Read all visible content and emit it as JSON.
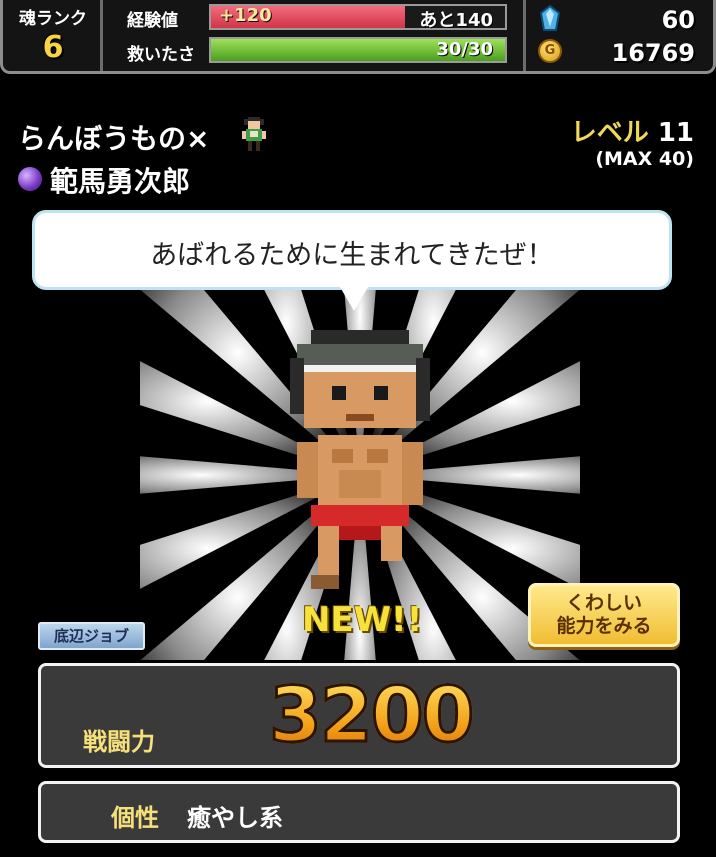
{
  "topbar": {
    "soul_rank_label": "魂ランク",
    "soul_rank_value": "6",
    "exp_label": "経験値",
    "exp_gain": "+120",
    "exp_remaining": "あと140",
    "exp_fill_fraction": 0.66,
    "rescued_label": "救いたさ",
    "rescued_value": "30/30",
    "rescued_fill_fraction": 1.0,
    "crystals": "60",
    "gold": "16769",
    "coin_glyph": "G"
  },
  "character": {
    "title": "らんぼうもの×",
    "name": "範馬勇次郎",
    "level_label": "レベル",
    "level_value": "11",
    "level_max": "(MAX 40)"
  },
  "speech": {
    "text": "あばれるために生まれてきたぜ！"
  },
  "badges": {
    "new": "NEW!!",
    "job": "底辺ジョブ"
  },
  "buttons": {
    "detail_line1": "くわしい",
    "detail_line2": "能力をみる"
  },
  "stats": {
    "power_label": "戦闘力",
    "power_value": "3200",
    "trait_label": "個性",
    "trait_value": "癒やし系"
  },
  "colors": {
    "accent_yellow": "#f6e07a",
    "exp_bar": "#d13447",
    "hp_bar": "#4c9e1f"
  }
}
